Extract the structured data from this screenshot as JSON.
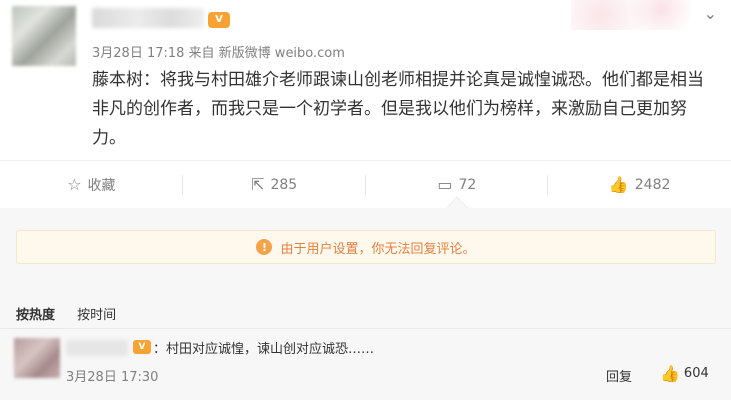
{
  "post": {
    "vip_badge": "V",
    "meta": "3月28日 17:18 来自 新版微博 weibo.com",
    "content": "藤本树：将我与村田雄介老师跟谏山创老师相提并论真是诚惶诚恐。他们都是相当非凡的创作者，而我只是一个初学者。但是我以他们为榜样，来激励自己更加努力。",
    "menu_icon": "chevron-down-icon"
  },
  "actions": {
    "favorite": {
      "icon": "star-icon",
      "label": "收藏"
    },
    "repost": {
      "icon": "share-icon",
      "count": "285"
    },
    "comment": {
      "icon": "comment-icon",
      "count": "72"
    },
    "like": {
      "icon": "thumbs-up-icon",
      "count": "2482"
    }
  },
  "notice": {
    "icon": "warning-icon",
    "text": "由于用户设置，你无法回复评论。"
  },
  "sort": {
    "hot": "按热度",
    "time": "按时间"
  },
  "comment": {
    "badge": "V",
    "text": "：村田对应诚惶，谏山创对应诚恐……",
    "time": "3月28日 17:30",
    "reply": "回复",
    "likes": "604"
  },
  "colors": {
    "notice_bg": "#fff8ed",
    "notice_text": "#e3813f",
    "badge": "#f7a233"
  }
}
